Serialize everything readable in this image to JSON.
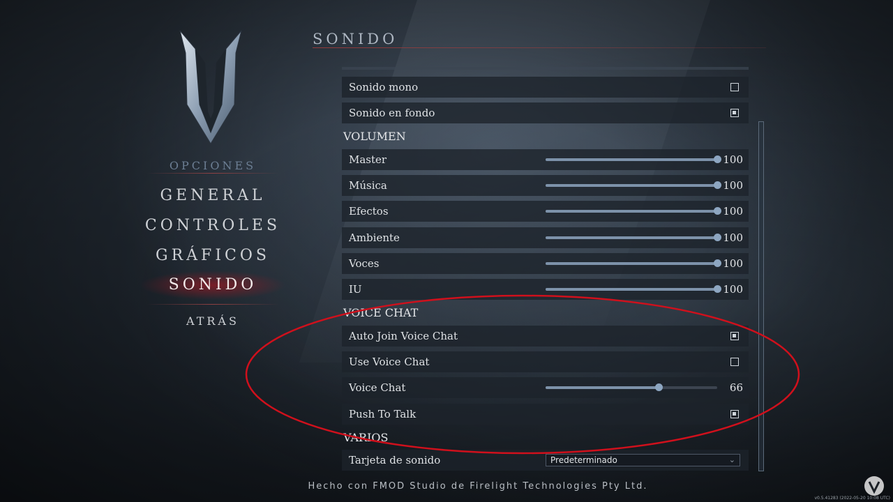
{
  "menu": {
    "title": "OPCIONES",
    "items": [
      {
        "label": "GENERAL"
      },
      {
        "label": "CONTROLES"
      },
      {
        "label": "GRÁFICOS"
      },
      {
        "label": "SONIDO"
      }
    ],
    "back_label": "ATRÁS"
  },
  "section": {
    "title": "SONIDO"
  },
  "toggles": {
    "mono": {
      "label": "Sonido mono",
      "checked": false
    },
    "background": {
      "label": "Sonido en fondo",
      "checked": true
    }
  },
  "volume": {
    "title": "VOLUMEN",
    "sliders": [
      {
        "label": "Master",
        "value": "100",
        "fraction": 1.0
      },
      {
        "label": "Música",
        "value": "100",
        "fraction": 1.0
      },
      {
        "label": "Efectos",
        "value": "100",
        "fraction": 1.0
      },
      {
        "label": "Ambiente",
        "value": "100",
        "fraction": 1.0
      },
      {
        "label": "Voces",
        "value": "100",
        "fraction": 1.0
      },
      {
        "label": "IU",
        "value": "100",
        "fraction": 1.0
      }
    ]
  },
  "voice_chat": {
    "title": "VOICE CHAT",
    "auto_join": {
      "label": "Auto Join Voice Chat",
      "checked": true
    },
    "use": {
      "label": "Use Voice Chat",
      "checked": false
    },
    "volume": {
      "label": "Voice Chat",
      "value": "66",
      "fraction": 0.66
    },
    "push_to_talk": {
      "label": "Push To Talk",
      "checked": true
    }
  },
  "misc": {
    "title": "VARIOS",
    "sound_card": {
      "label": "Tarjeta de sonido",
      "selected": "Predeterminado"
    }
  },
  "footer": {
    "credit": "Hecho con FMOD Studio de Firelight Technologies Pty Ltd.",
    "version": "v0.5.41283 (2022-05-20 10:08 UTC)"
  },
  "colors": {
    "accent_red": "#d0101c",
    "slider_fill": "#7d92aa"
  }
}
